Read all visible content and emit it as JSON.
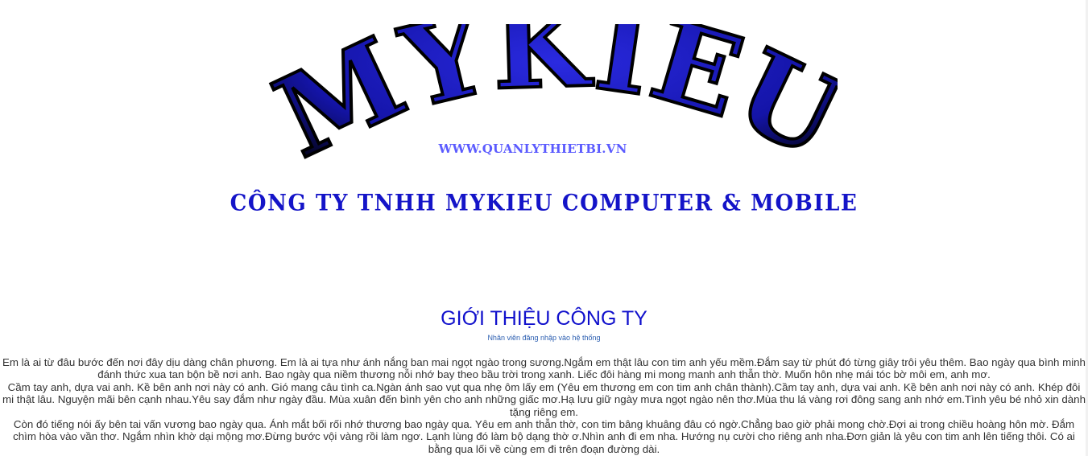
{
  "logo": {
    "brand": "MYKIEU",
    "url_text": "WWW.QUANLYTHIETBI.VN",
    "colors": {
      "fill": "#1a1ab8",
      "shade": "#000000"
    }
  },
  "company_name": "CÔNG TY TNHH MYKIEU COMPUTER & MOBILE",
  "section": {
    "title": "GIỚI THIỆU CÔNG TY",
    "subtitle": "Nhân viên đăng nhập vào hệ thống"
  },
  "intro_paragraphs": [
    "Em là ai từ đâu bước đến nơi đây dịu dàng chân phương. Em là ai tựa như ánh nắng ban mai ngọt ngào trong sương.Ngắm em thật lâu con tim anh yếu mềm.Đắm say từ phút đó từng giây trôi yêu thêm. Bao ngày qua bình minh đánh thức xua tan bộn bề nơi anh. Bao ngày qua niềm thương nỗi nhớ bay theo bầu trời trong xanh. Liếc đôi hàng mi mong manh anh thẫn thờ. Muốn hôn nhẹ mái tóc bờ môi em, anh mơ.",
    "Cầm tay anh, dựa vai anh. Kề bên anh nơi này có anh. Gió mang câu tình ca.Ngàn ánh sao vụt qua nhẹ ôm lấy em (Yêu em thương em con tim anh chân thành).Cầm tay anh, dựa vai anh. Kề bên anh nơi này có anh. Khép đôi mi thật lâu. Nguyện mãi bên cạnh nhau.Yêu say đắm như ngày đầu. Mùa xuân đến bình yên cho anh những giấc mơ.Hạ lưu giữ ngày mưa ngọt ngào nên thơ.Mùa thu lá vàng rơi đông sang anh nhớ em.Tình yêu bé nhỏ xin dành tặng riêng em.",
    "Còn đó tiếng nói ấy bên tai vấn vương bao ngày qua. Ánh mắt bối rối nhớ thương bao ngày qua. Yêu em anh thẫn thờ, con tim bâng khuâng đâu có ngờ.Chẳng bao giờ phải mong chờ.Đợi ai trong chiều hoàng hôn mờ. Đắm chìm hòa vào vần thơ. Ngắm nhìn khờ dại mộng mơ.Đừng bước vội vàng rồi làm ngơ. Lạnh lùng đó làm bộ dạng thờ ơ.Nhìn anh đi em nha. Hướng nụ cười cho riêng anh nha.Đơn giản là yêu con tim anh lên tiếng thôi. Có ai bằng qua lối về cùng em đi trên đoạn đường dài."
  ]
}
